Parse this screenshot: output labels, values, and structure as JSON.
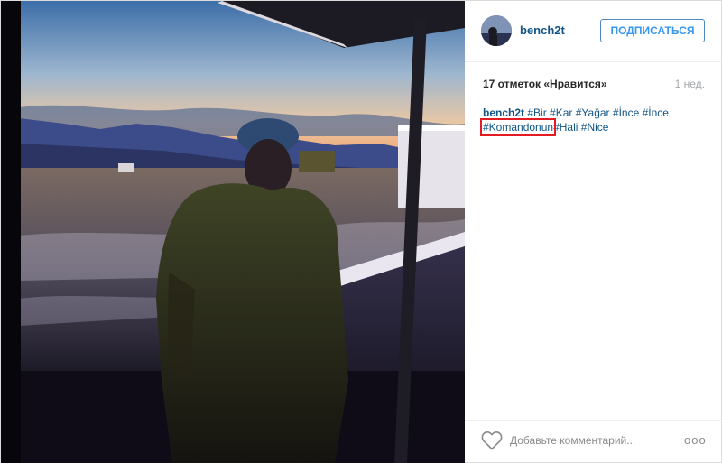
{
  "post": {
    "username": "bench2t",
    "follow_label": "ПОДПИСАТЬСЯ",
    "likes_text": "17 отметок «Нравится»",
    "time_ago": "1 нед.",
    "caption": {
      "author": "bench2t",
      "hashtags": [
        "#Bir",
        "#Kar",
        "#Yağar",
        "#İnce",
        "#İnce",
        "#Komandonun",
        "#Hali",
        "#Nice"
      ]
    },
    "comment_placeholder": "Добавьте комментарий...",
    "more_label": "ooo"
  },
  "icons": {
    "like": "heart-icon",
    "options": "more-options-icon"
  },
  "colors": {
    "link": "#125688",
    "follow_text": "#3897f0",
    "highlight_box": "#e51b24"
  }
}
